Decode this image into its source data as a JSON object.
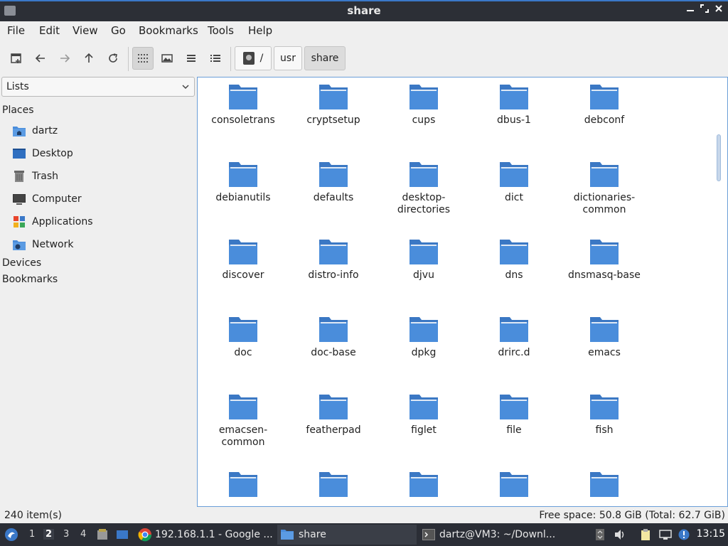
{
  "window": {
    "title": "share",
    "controls": [
      "minimize-icon",
      "maximize-icon",
      "close-icon"
    ]
  },
  "menubar": {
    "items": [
      "File",
      "Edit",
      "View",
      "Go",
      "Bookmarks",
      "Tools",
      "Help"
    ]
  },
  "toolbar": {
    "buttons": [
      "new-tab-icon",
      "back-icon",
      "forward-icon",
      "up-icon",
      "reload-icon",
      "icon-view-icon",
      "thumbnail-view-icon",
      "compact-view-icon",
      "detailed-list-icon"
    ],
    "active_view": "icon-view",
    "path": [
      {
        "label": "/",
        "icon": "drive-icon"
      },
      {
        "label": "usr"
      },
      {
        "label": "share"
      }
    ]
  },
  "side_pane": {
    "mode_select": "Lists",
    "places_header": "Places",
    "places": [
      {
        "label": "dartz",
        "icon": "home-folder-icon"
      },
      {
        "label": "Desktop",
        "icon": "desktop-icon"
      },
      {
        "label": "Trash",
        "icon": "trash-icon"
      },
      {
        "label": "Computer",
        "icon": "computer-icon"
      },
      {
        "label": "Applications",
        "icon": "applications-icon"
      },
      {
        "label": "Network",
        "icon": "network-icon"
      }
    ],
    "devices_header": "Devices",
    "bookmarks_header": "Bookmarks"
  },
  "folders": [
    [
      "consoletrans"
    ],
    [
      "cryptsetup"
    ],
    [
      "cups"
    ],
    [
      "dbus-1"
    ],
    [
      "debconf"
    ],
    [
      "debianutils"
    ],
    [
      "defaults"
    ],
    [
      "desktop-",
      "directories"
    ],
    [
      "dict"
    ],
    [
      "dictionaries-",
      "common"
    ],
    [
      "discover"
    ],
    [
      "distro-info"
    ],
    [
      "djvu"
    ],
    [
      "dns"
    ],
    [
      "dnsmasq-base"
    ],
    [
      "doc"
    ],
    [
      "doc-base"
    ],
    [
      "dpkg"
    ],
    [
      "drirc.d"
    ],
    [
      "emacs"
    ],
    [
      "emacsen-",
      "common"
    ],
    [
      "featherpad"
    ],
    [
      "figlet"
    ],
    [
      "file"
    ],
    [
      "fish"
    ],
    [
      ""
    ],
    [
      ""
    ],
    [
      ""
    ],
    [
      ""
    ],
    [
      ""
    ]
  ],
  "status": {
    "item_count": "240 item(s)",
    "free_space": "Free space: 50.8 GiB (Total: 62.7 GiB)"
  },
  "taskbar": {
    "workspaces": [
      "1",
      "2",
      "3",
      "4"
    ],
    "current_workspace": "2",
    "tasks": [
      {
        "label": "192.168.1.1 - Google ...",
        "icon": "chrome-icon"
      },
      {
        "label": "share",
        "icon": "folder-icon"
      },
      {
        "label": "dartz@VM3: ~/Downl...",
        "icon": "terminal-icon"
      }
    ],
    "clock": "13:15"
  },
  "colors": {
    "accent": "#3a78c8",
    "folder": "#4a8ddb",
    "taskbar_bg": "#2b2e36"
  }
}
